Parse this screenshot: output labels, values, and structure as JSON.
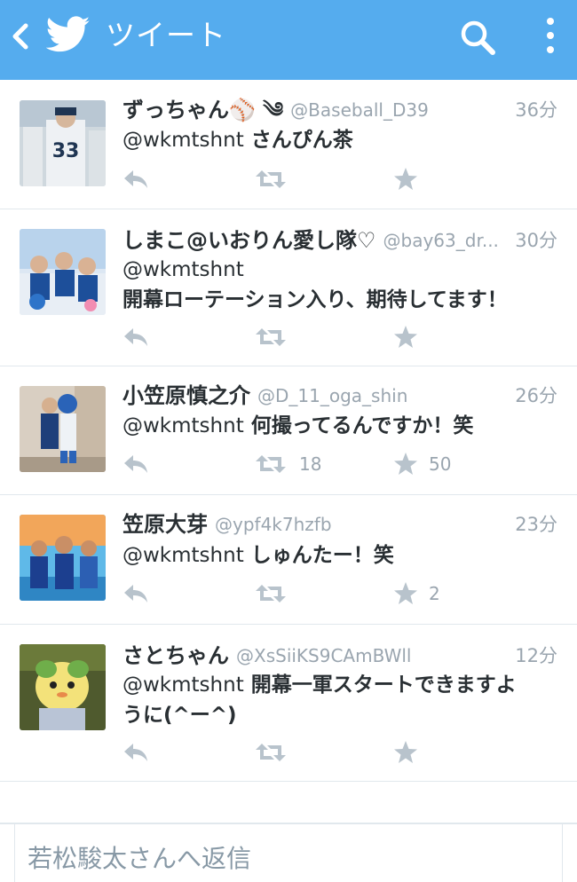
{
  "header": {
    "title": "ツイート",
    "bg_color": "#55acee",
    "icons": {
      "back": "chevron-left-icon",
      "logo": "twitter-bird-icon",
      "search": "search-icon",
      "menu": "overflow-menu-icon"
    }
  },
  "tweets": [
    {
      "name": "ずっちゃん⚾ ༄",
      "handle": "@Baseball_D39",
      "time": "36分",
      "mention": "@wkmtshnt",
      "text": " さんぴん茶",
      "text2": "",
      "retweets": "",
      "favorites": ""
    },
    {
      "name": "しまこ@いおりん愛し隊♡",
      "handle": "@bay63_dr...",
      "time": "30分",
      "mention": "@wkmtshnt",
      "text": "",
      "text2": "開幕ローテーション入り、期待してます！",
      "retweets": "",
      "favorites": ""
    },
    {
      "name": "小笠原慎之介",
      "handle": "@D_11_oga_shin",
      "time": "26分",
      "mention": "@wkmtshnt",
      "text": " 何撮ってるんですか！笑",
      "text2": "",
      "retweets": "18",
      "favorites": "50"
    },
    {
      "name": "笠原大芽",
      "handle": "@ypf4k7hzfb",
      "time": "23分",
      "mention": "@wkmtshnt",
      "text": " しゅんたー！笑",
      "text2": "",
      "retweets": "",
      "favorites": "2"
    },
    {
      "name": "さとちゃん",
      "handle": "@XsSiiKS9CAmBWll",
      "time": "12分",
      "mention": "@wkmtshnt",
      "text": " 開幕一軍スタートできますよ",
      "text2": "うに(^ー^)",
      "retweets": "",
      "favorites": ""
    }
  ],
  "reply": {
    "placeholder": "若松駿太さんへ返信"
  },
  "colors": {
    "accent": "#55acee",
    "muted": "#9aa5af",
    "icon_gray": "#b8c3cc",
    "divider": "#e1e8ed"
  }
}
